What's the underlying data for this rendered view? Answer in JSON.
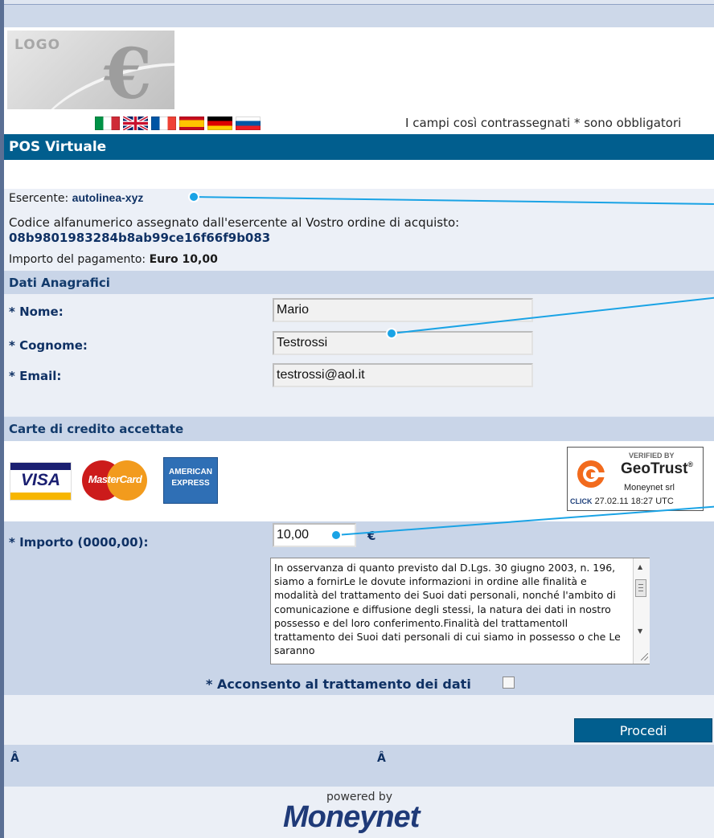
{
  "header": {
    "logo_text": "LOGO",
    "logo_symbol": "€",
    "languages": [
      "Italiano",
      "English",
      "Français",
      "Español",
      "Deutsch",
      "Slovenščina"
    ],
    "required_note": "I campi così contrassegnati * sono obbligatori"
  },
  "title": "POS Virtuale",
  "info": {
    "merchant_label": "Esercente:",
    "merchant_value": "autolinea-xyz",
    "order_code_label": "Codice alfanumerico assegnato dall'esercente al Vostro ordine di acquisto:",
    "order_code_value": "08b9801983284b8ab99ce16f66f9b083",
    "amount_label": "Importo del pagamento:",
    "amount_value": "Euro 10,00"
  },
  "personal": {
    "section_title": "Dati Anagrafici",
    "name_label": "* Nome:",
    "name_value": "Mario",
    "surname_label": "* Cognome:",
    "surname_value": "Testrossi",
    "email_label": "* Email:",
    "email_value": "testrossi@aol.it"
  },
  "cards": {
    "section_title": "Carte di credito accettate",
    "visa": "VISA",
    "mastercard": "MasterCard",
    "amex_line1": "AMERICAN",
    "amex_line2": "EXPRESS",
    "geotrust_verified": "VERIFIED BY",
    "geotrust_brand": "GeoTrust",
    "geotrust_tm": "®",
    "geotrust_company": "Moneynet srl",
    "geotrust_click": "CLICK",
    "geotrust_date": "27.02.11 18:27 UTC"
  },
  "payment": {
    "amount_label": "* Importo (0000,00):",
    "amount_value": "10,00",
    "currency": "€",
    "privacy_text": "In osservanza di quanto previsto dal D.Lgs. 30 giugno 2003, n. 196, siamo a fornirLe le dovute informazioni in ordine alle finalità e modalità del trattamento dei Suoi dati personali, nonché l'ambito di comunicazione e diffusione degli stessi, la natura dei dati in nostro possesso e del loro conferimento.Finalità del trattamentoIl trattamento dei Suoi dati personali di cui siamo in possesso o che Le saranno",
    "consent_label": "* Acconsento al trattamento dei dati",
    "submit_label": "Procedi"
  },
  "footer": {
    "row_left": "Â",
    "row_center": "Â",
    "powered_by": "powered by",
    "brand": "Moneynet"
  },
  "colors": {
    "title_bar": "#015e8e",
    "section_bg": "#c9d5e8",
    "label_text": "#0f3164",
    "callout": "#1aa3e5"
  }
}
